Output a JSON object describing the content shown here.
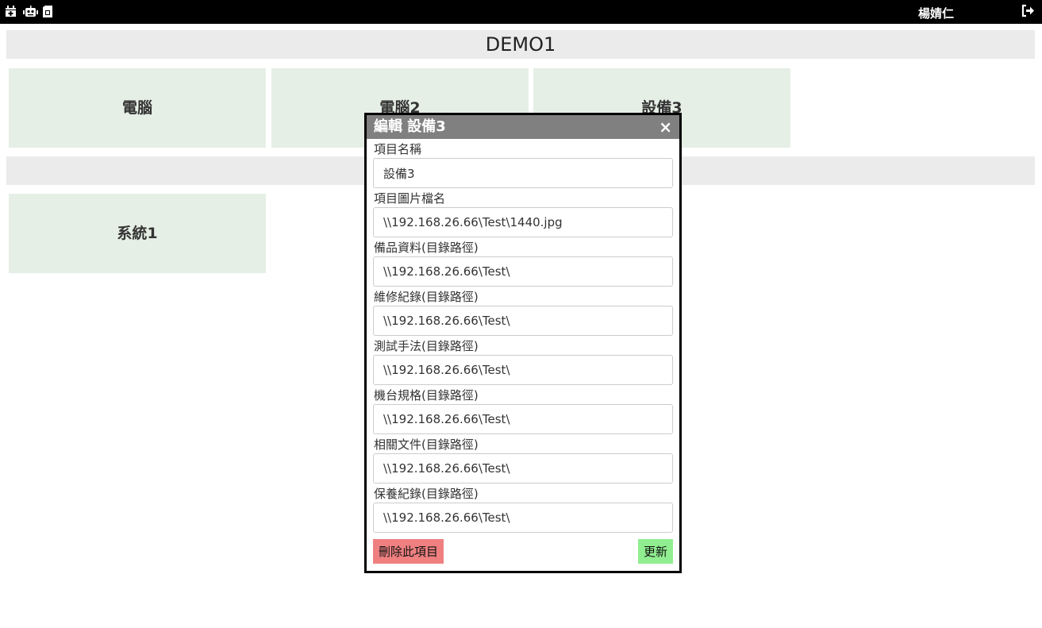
{
  "topbar": {
    "icons": [
      "calendar-plus-icon",
      "robot-icon",
      "sim-card-icon"
    ],
    "user_name": "楊婧仁",
    "logout_icon": "sign-out-icon"
  },
  "groups": [
    {
      "title": "DEMO1",
      "items": [
        "電腦",
        "電腦2",
        "設備3"
      ]
    },
    {
      "title": "",
      "items": [
        "系統1"
      ]
    }
  ],
  "modal": {
    "title": "編輯 設備3",
    "close_label": "×",
    "fields": [
      {
        "label": "項目名稱",
        "value": "設備3"
      },
      {
        "label": "項目圖片檔名",
        "value": "\\\\192.168.26.66\\Test\\1440.jpg"
      },
      {
        "label": "備品資料(目錄路徑)",
        "value": "\\\\192.168.26.66\\Test\\"
      },
      {
        "label": "維修紀錄(目錄路徑)",
        "value": "\\\\192.168.26.66\\Test\\"
      },
      {
        "label": "測試手法(目錄路徑)",
        "value": "\\\\192.168.26.66\\Test\\"
      },
      {
        "label": "機台規格(目錄路徑)",
        "value": "\\\\192.168.26.66\\Test\\"
      },
      {
        "label": "相關文件(目錄路徑)",
        "value": "\\\\192.168.26.66\\Test\\"
      },
      {
        "label": "保養紀錄(目錄路徑)",
        "value": "\\\\192.168.26.66\\Test\\"
      }
    ],
    "delete_label": "刪除此項目",
    "update_label": "更新"
  },
  "colors": {
    "topbar": "#000000",
    "section_header": "#ebebeb",
    "tile": "#e6efe6",
    "modal_header": "#808080",
    "delete_button": "#f08080",
    "update_button": "#90ee90"
  }
}
